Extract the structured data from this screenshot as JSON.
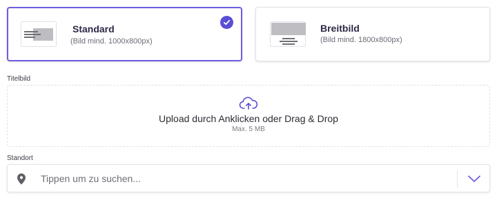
{
  "format_options": [
    {
      "title": "Standard",
      "subtitle": "(Bild mind. 1000x800px)",
      "selected": true
    },
    {
      "title": "Breitbild",
      "subtitle": "(Bild mind. 1800x800px)",
      "selected": false
    }
  ],
  "cover_image": {
    "label": "Titelbild",
    "upload_text": "Upload durch Anklicken oder Drag & Drop",
    "max_size": "Max. 5 MB"
  },
  "location": {
    "label": "Standort",
    "placeholder": "Tippen um zu suchen..."
  },
  "icons": {
    "check": "check-icon",
    "upload": "cloud-upload-icon",
    "location": "map-pin-icon",
    "dropdown": "chevron-down-icon"
  },
  "colors": {
    "accent": "#5b4ed6",
    "selected_border": "#6c5ce0",
    "thumb_gray": "#bcbcc2"
  }
}
